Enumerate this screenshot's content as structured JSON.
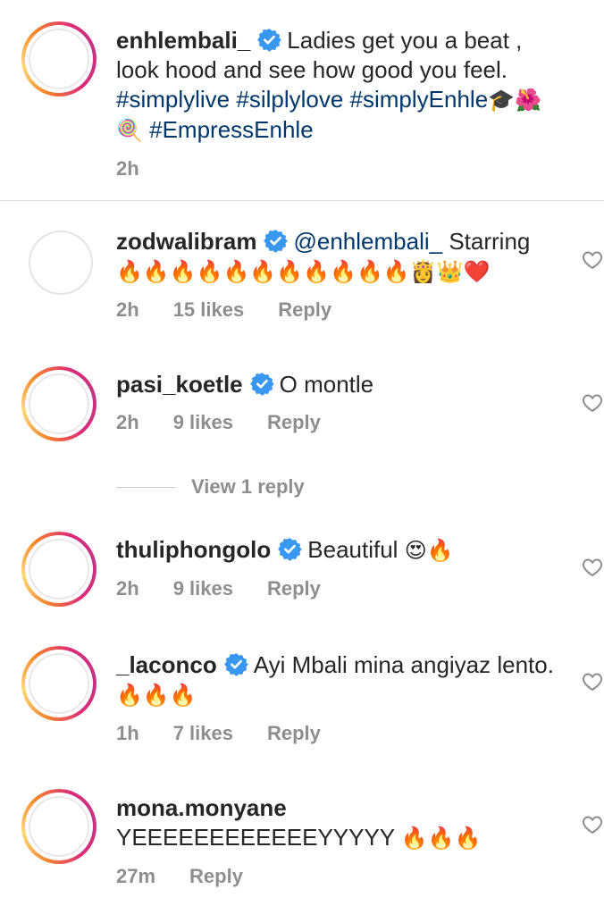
{
  "caption": {
    "username": "enhlembali_",
    "text": "Ladies get you a beat , look hood and see how good you feel.",
    "hashtags": "#simplylive #silplylove #simplyEnhle",
    "emoji_a": "🎓🌺",
    "emoji_b": "🍭",
    "hashtag_2": "#EmpressEnhle",
    "time": "2h"
  },
  "comments": [
    {
      "username": "zodwalibram",
      "mention": "@enhlembali_",
      "text": "Starring",
      "emoji": "🔥🔥🔥🔥🔥🔥🔥🔥🔥🔥🔥👸👑❤️",
      "time": "2h",
      "likes": "15 likes",
      "reply": "Reply"
    },
    {
      "username": "pasi_koetle",
      "text": "O montle",
      "time": "2h",
      "likes": "9 likes",
      "reply": "Reply",
      "view_replies": "View 1 reply"
    },
    {
      "username": "thuliphongolo",
      "text": "Beautiful",
      "emoji": "😍🔥",
      "time": "2h",
      "likes": "9 likes",
      "reply": "Reply"
    },
    {
      "username": "_laconco",
      "text": "Ayi Mbali mina angiyaz lento.",
      "emoji": "🔥🔥🔥",
      "time": "1h",
      "likes": "7 likes",
      "reply": "Reply"
    },
    {
      "username": "mona.monyane",
      "text": "YEEEEEEEEEEEEYYYYY",
      "emoji": "🔥🔥🔥",
      "time": "27m",
      "reply": "Reply"
    }
  ],
  "colors": {
    "verified": "#3897f0",
    "hashtag": "#00376b",
    "meta": "#8e8e8e"
  }
}
